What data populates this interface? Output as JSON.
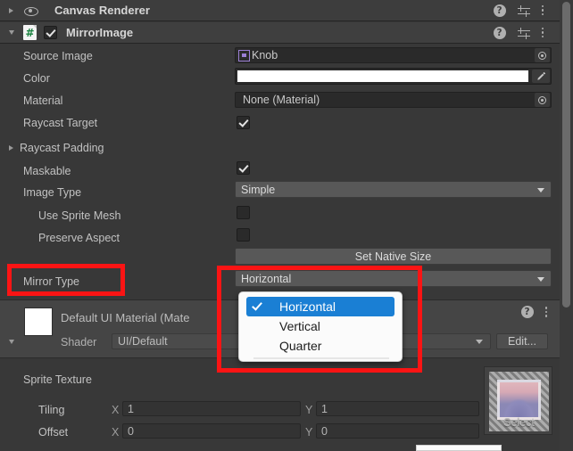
{
  "window": {
    "background_color": "#383838",
    "accent_color": "#1a7fd4",
    "annotation_color": "#fb1414"
  },
  "components": [
    {
      "title": "Canvas Renderer",
      "icon": "eye-icon",
      "expanded": false,
      "enabled_toggle": false
    },
    {
      "title": "MirrorImage",
      "icon": "csharp-script-icon",
      "expanded": true,
      "enabled_toggle": true
    }
  ],
  "header_icons": {
    "help": "?",
    "help_name": "help-icon",
    "preset_name": "preset-icon",
    "menu_name": "kebab-menu-icon"
  },
  "properties": {
    "source_image": {
      "label": "Source Image",
      "value": "Knob",
      "type": "object-field"
    },
    "color": {
      "label": "Color",
      "value": "#FFFFFF",
      "type": "color-field"
    },
    "material": {
      "label": "Material",
      "value": "None (Material)",
      "type": "object-field"
    },
    "raycast_target": {
      "label": "Raycast Target",
      "value": true,
      "type": "checkbox"
    },
    "raycast_padding": {
      "label": "Raycast Padding",
      "type": "foldout",
      "expanded": false
    },
    "maskable": {
      "label": "Maskable",
      "value": true,
      "type": "checkbox"
    },
    "image_type": {
      "label": "Image Type",
      "value": "Simple",
      "type": "dropdown"
    },
    "use_sprite_mesh": {
      "label": "Use Sprite Mesh",
      "value": false,
      "type": "checkbox"
    },
    "preserve_aspect": {
      "label": "Preserve Aspect",
      "value": false,
      "type": "checkbox"
    },
    "set_native_size": {
      "label": "Set Native Size",
      "type": "button"
    },
    "mirror_type": {
      "label": "Mirror Type",
      "value": "Horizontal",
      "type": "dropdown"
    }
  },
  "mirror_type_dropdown": {
    "open": true,
    "selected": "Horizontal",
    "options": [
      {
        "label": "Horizontal",
        "checked": true
      },
      {
        "label": "Vertical",
        "checked": false
      },
      {
        "label": "Quarter",
        "checked": false
      }
    ]
  },
  "material_block": {
    "title": "Default UI Material (Mate",
    "shader_label": "Shader",
    "shader_value": "UI/Default",
    "edit_label": "Edit...",
    "swatch_color": "#FFFFFF"
  },
  "sprite_texture": {
    "section_label": "Sprite Texture",
    "tiling": {
      "label": "Tiling",
      "x_label": "X",
      "x": "1",
      "y_label": "Y",
      "y": "1"
    },
    "offset": {
      "label": "Offset",
      "x_label": "X",
      "x": "0",
      "y_label": "Y",
      "y": "0"
    },
    "preview_select_label": "Select"
  }
}
